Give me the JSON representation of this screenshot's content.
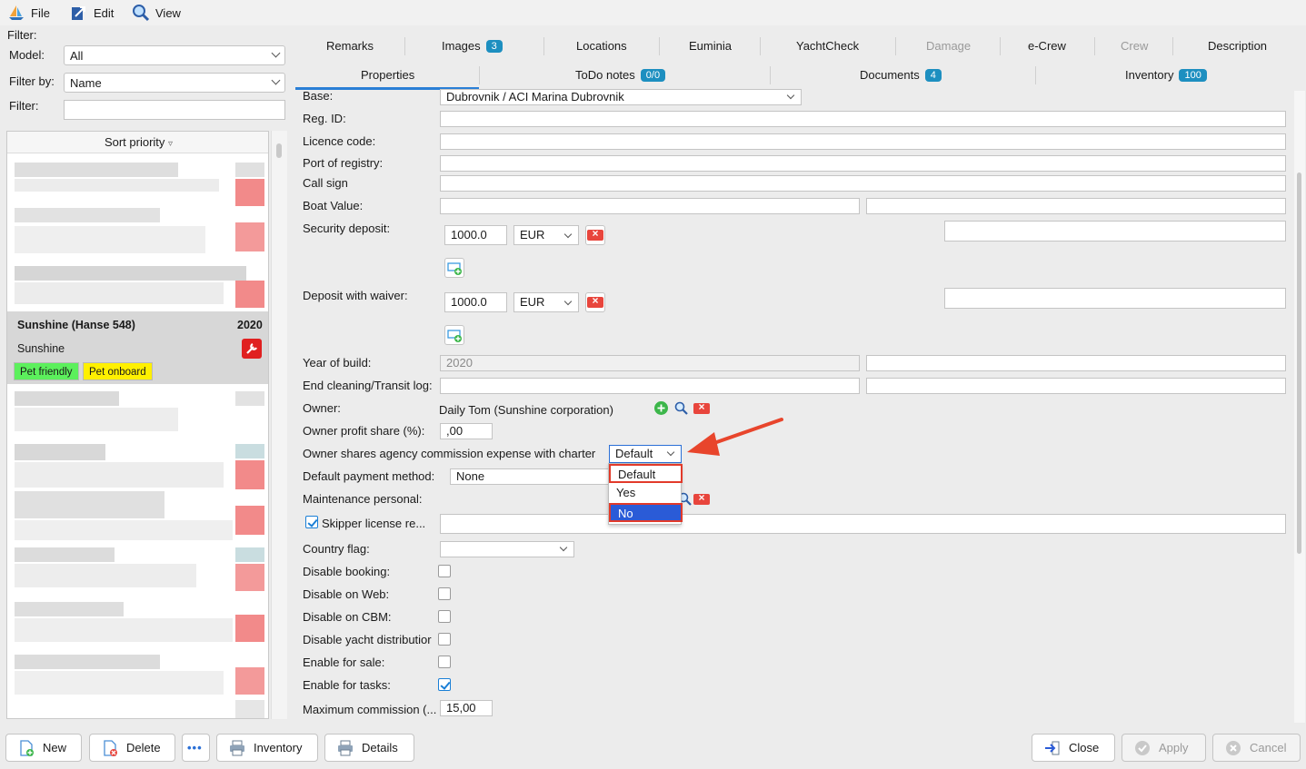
{
  "menu": [
    {
      "label": "File",
      "icon": "sailboat-icon"
    },
    {
      "label": "Edit",
      "icon": "edit-arrow-icon"
    },
    {
      "label": "View",
      "icon": "magnifier-icon"
    }
  ],
  "filter": {
    "section_label": "Filter:",
    "model_label": "Model:",
    "model_value": "All",
    "filter_by_label": "Filter by:",
    "filter_by_value": "Name",
    "filter_label": "Filter:",
    "filter_value": ""
  },
  "list": {
    "header": "Sort priority",
    "sort_glyph": "▿",
    "selected": {
      "name": "Sunshine (Hanse 548)",
      "year": "2020",
      "subtitle": "Sunshine",
      "tags": [
        "Pet friendly",
        "Pet onboard"
      ]
    }
  },
  "tabs_row1": [
    {
      "label": "Remarks"
    },
    {
      "label": "Images",
      "badge": "3"
    },
    {
      "label": "Locations"
    },
    {
      "label": "Euminia"
    },
    {
      "label": "YachtCheck"
    },
    {
      "label": "Damage",
      "disabled": true
    },
    {
      "label": "e-Crew"
    },
    {
      "label": "Crew",
      "disabled": true
    },
    {
      "label": "Description"
    }
  ],
  "tabs_row2": [
    {
      "label": "Properties",
      "active": true
    },
    {
      "label": "ToDo notes",
      "badge": "0/0"
    },
    {
      "label": "Documents",
      "badge": "4"
    },
    {
      "label": "Inventory",
      "badge": "100"
    }
  ],
  "form": {
    "base_label": "Base:",
    "base_value": "Dubrovnik / ACI Marina Dubrovnik",
    "reg_id_label": "Reg. ID:",
    "licence_label": "Licence code:",
    "port_label": "Port of registry:",
    "call_sign_label": "Call sign",
    "boat_value_label": "Boat Value:",
    "security_deposit_label": "Security deposit:",
    "security_deposit_value": "1000.0",
    "security_deposit_currency": "EUR",
    "deposit_waiver_label": "Deposit with waiver:",
    "deposit_waiver_value": "1000.0",
    "deposit_waiver_currency": "EUR",
    "year_label": "Year of build:",
    "year_value": "2020",
    "end_cleaning_label": "End cleaning/Transit log:",
    "owner_label": "Owner:",
    "owner_value": "Daily Tom (Sunshine corporation)",
    "owner_profit_label": "Owner profit share (%):",
    "owner_profit_value": ",00",
    "owner_shares_label": "Owner shares agency commission expense with charter",
    "owner_shares_value": "Default",
    "owner_shares_options": [
      "Default",
      "Yes",
      "No"
    ],
    "payment_label": "Default payment method:",
    "payment_value": "None",
    "maintenance_label": "Maintenance personal:",
    "skipper_label": "Skipper license re...",
    "country_flag_label": "Country flag:",
    "disable_booking_label": "Disable booking:",
    "disable_web_label": "Disable on Web:",
    "disable_cbm_label": "Disable on CBM:",
    "disable_yacht_label": "Disable yacht distributior",
    "enable_sale_label": "Enable for sale:",
    "enable_tasks_label": "Enable for tasks:",
    "max_commission_label": "Maximum commission (...",
    "max_commission_value": "15,00"
  },
  "buttons": {
    "new": "New",
    "delete": "Delete",
    "more": "•••",
    "inventory": "Inventory",
    "details": "Details",
    "close": "Close",
    "apply": "Apply",
    "cancel": "Cancel"
  },
  "colors": {
    "badge": "#1d8fc0",
    "highlight_red": "#e23a2a",
    "selected_option": "#2a5bd7",
    "tag_green": "#5cf05c",
    "tag_yellow": "#fff000"
  }
}
